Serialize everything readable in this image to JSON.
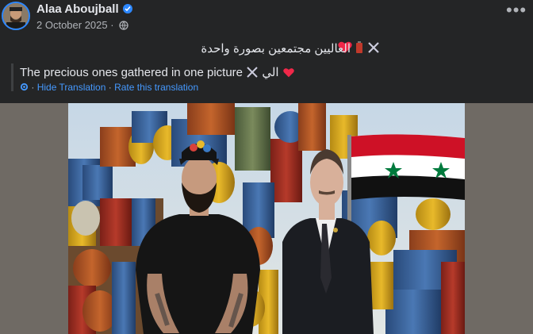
{
  "post": {
    "author": "Alaa Aboujball",
    "date": "2 October 2025",
    "arabic_text": "العاليين مجتمعين بصورة واحدة",
    "translation": "The precious ones gathered in one picture",
    "translation_suffix": "الي",
    "hide_translation": "Hide Translation",
    "separator": "·",
    "rate_translation": "Rate this translation",
    "more_label": "•••"
  },
  "icons": {
    "verified": "verified-badge-icon",
    "privacy": "globe-icon",
    "translate": "translate-gear-icon",
    "more": "more-options-icon"
  },
  "colors": {
    "background": "#242526",
    "link": "#4599ff",
    "verified": "#2d88ff",
    "heart": "#f02849"
  }
}
